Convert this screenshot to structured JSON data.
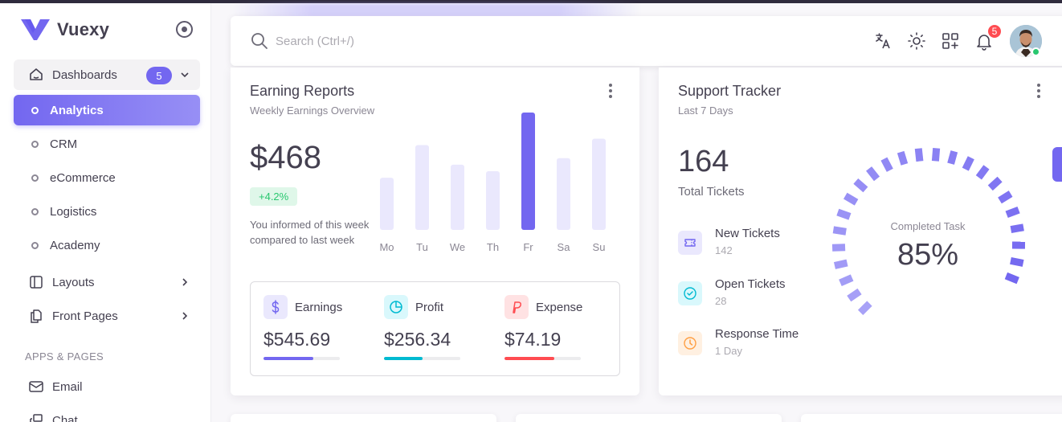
{
  "brand": {
    "name": "Vuexy"
  },
  "sidebar": {
    "dashboards": {
      "label": "Dashboards",
      "count": "5"
    },
    "sub_items": [
      "Analytics",
      "CRM",
      "eCommerce",
      "Logistics",
      "Academy"
    ],
    "layouts": "Layouts",
    "front_pages": "Front Pages",
    "section": "APPS & PAGES",
    "email": "Email",
    "chat": "Chat"
  },
  "topbar": {
    "search_placeholder": "Search (Ctrl+/)",
    "notifications_count": "5",
    "icons": [
      "translate-icon",
      "sun-icon",
      "shortcuts-icon",
      "bell-icon"
    ]
  },
  "earning": {
    "title": "Earning Reports",
    "subtitle": "Weekly Earnings Overview",
    "amount": "$468",
    "change": "+4.2%",
    "description": "You informed of this week compared to last week",
    "stats": [
      {
        "label": "Earnings",
        "value": "$545.69",
        "progress": 0.65,
        "color": "#7367f0"
      },
      {
        "label": "Profit",
        "value": "$256.34",
        "progress": 0.5,
        "color": "#00bad1"
      },
      {
        "label": "Expense",
        "value": "$74.19",
        "progress": 0.65,
        "color": "#ff4c51"
      }
    ]
  },
  "chart_data": {
    "type": "bar",
    "categories": [
      "Mo",
      "Tu",
      "We",
      "Th",
      "Fr",
      "Sa",
      "Su"
    ],
    "values": [
      40,
      65,
      50,
      45,
      90,
      55,
      70
    ],
    "highlight_index": 4,
    "colors": {
      "base": "#eae8fd",
      "highlight": "#7367f0"
    },
    "ylim": [
      0,
      90
    ],
    "title": "",
    "xlabel": "",
    "ylabel": ""
  },
  "support": {
    "title": "Support Tracker",
    "subtitle": "Last 7 Days",
    "total": "164",
    "total_label": "Total Tickets",
    "rows": [
      {
        "title": "New Tickets",
        "value": "142",
        "icon": "ticket-icon",
        "color": "#7367f0",
        "bg": "#eae8fd"
      },
      {
        "title": "Open Tickets",
        "value": "28",
        "icon": "check-circle-icon",
        "color": "#00bad1",
        "bg": "#d9f8fc"
      },
      {
        "title": "Response Time",
        "value": "1 Day",
        "icon": "clock-icon",
        "color": "#ff9f43",
        "bg": "#fff0e1"
      }
    ],
    "gauge_label": "Completed Task",
    "gauge_value": "85%",
    "gauge_percent": 85
  }
}
